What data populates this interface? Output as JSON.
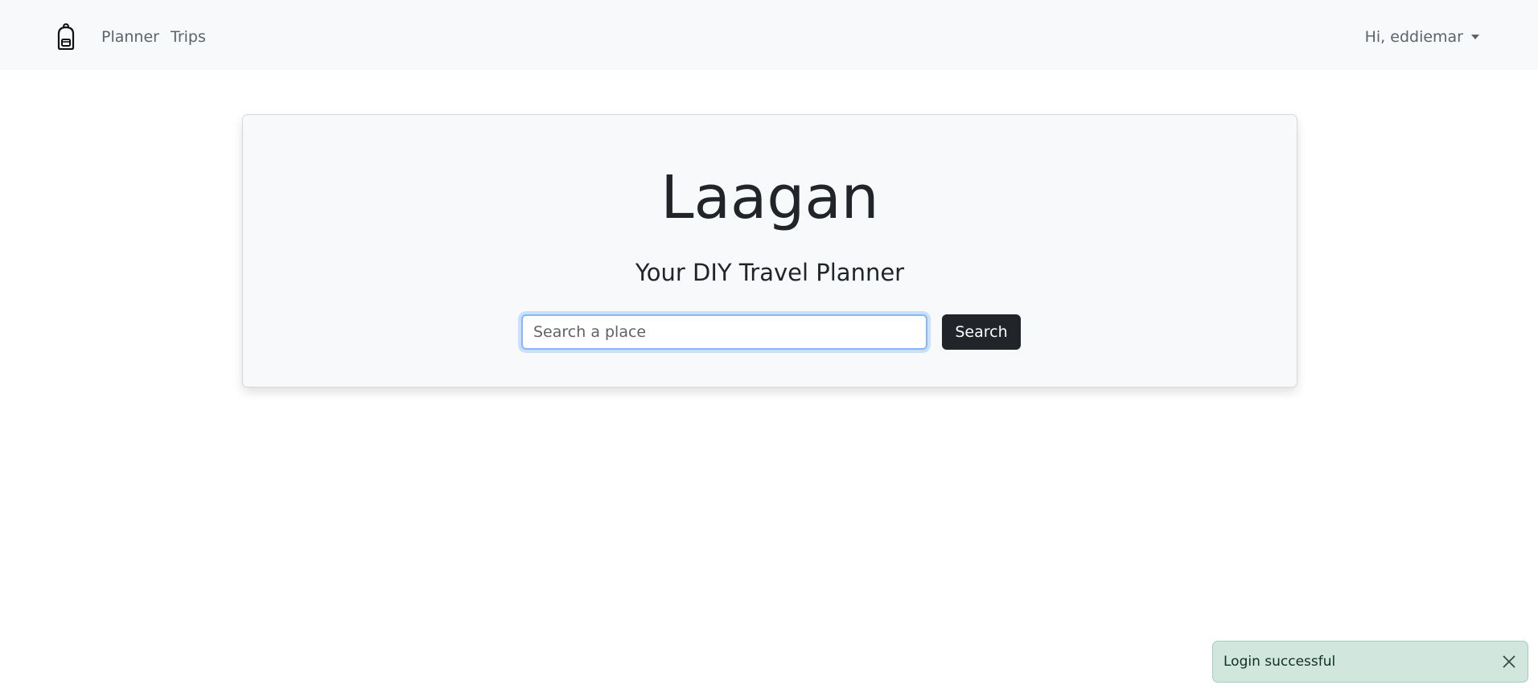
{
  "navbar": {
    "brand_icon": "backpack-icon",
    "links": [
      {
        "label": "Planner"
      },
      {
        "label": "Trips"
      }
    ],
    "user_menu_label": "Hi, eddiemar",
    "user_menu_icon": "caret-down-icon"
  },
  "hero": {
    "title": "Laagan",
    "subtitle": "Your DIY Travel Planner",
    "search": {
      "placeholder": "Search a place",
      "value": "",
      "button_label": "Search"
    }
  },
  "toast": {
    "message": "Login successful",
    "close_icon": "close-icon"
  },
  "colors": {
    "navbar_bg": "#f8f9fa",
    "button_dark": "#212529",
    "toast_success_bg": "#d1e7dd",
    "focus_border": "#86b7fe"
  }
}
